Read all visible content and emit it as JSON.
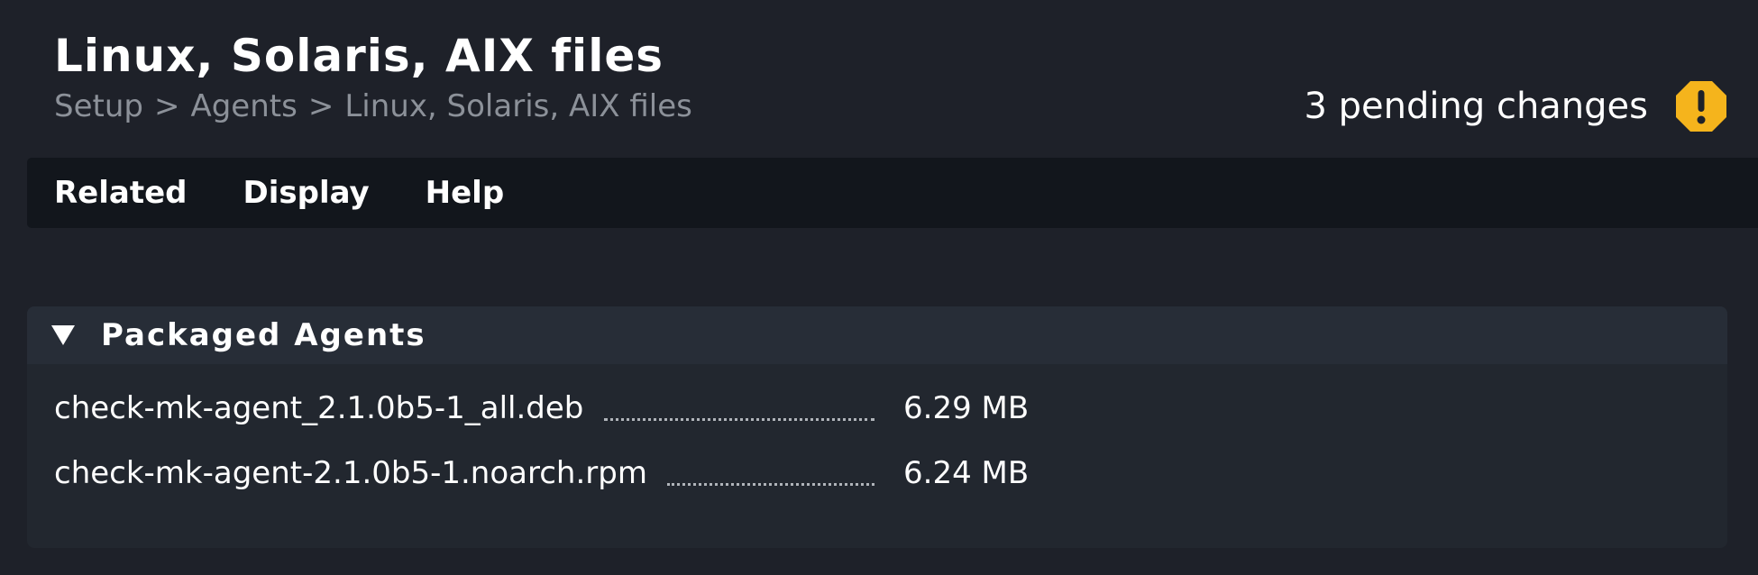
{
  "header": {
    "title": "Linux, Solaris, AIX files",
    "breadcrumb": [
      "Setup",
      "Agents",
      "Linux, Solaris, AIX files"
    ],
    "breadcrumb_separator": ">"
  },
  "pending_changes": {
    "label": "3 pending changes",
    "icon": "warning-octagon-icon",
    "icon_color": "#f5b41c"
  },
  "menu": {
    "items": [
      "Related",
      "Display",
      "Help"
    ]
  },
  "packaged_agents": {
    "title": "Packaged Agents",
    "toggle_icon": "triangle-down-icon",
    "files": [
      {
        "name": "check-mk-agent_2.1.0b5-1_all.deb",
        "size": "6.29 MB"
      },
      {
        "name": "check-mk-agent-2.1.0b5-1.noarch.rpm",
        "size": "6.24 MB"
      }
    ]
  },
  "colors": {
    "background": "#1e2129",
    "menubar": "#12161c",
    "panel": "#22272f",
    "panel_header": "#272d37",
    "breadcrumb_text": "#8c9199",
    "warning": "#f5b41c"
  }
}
